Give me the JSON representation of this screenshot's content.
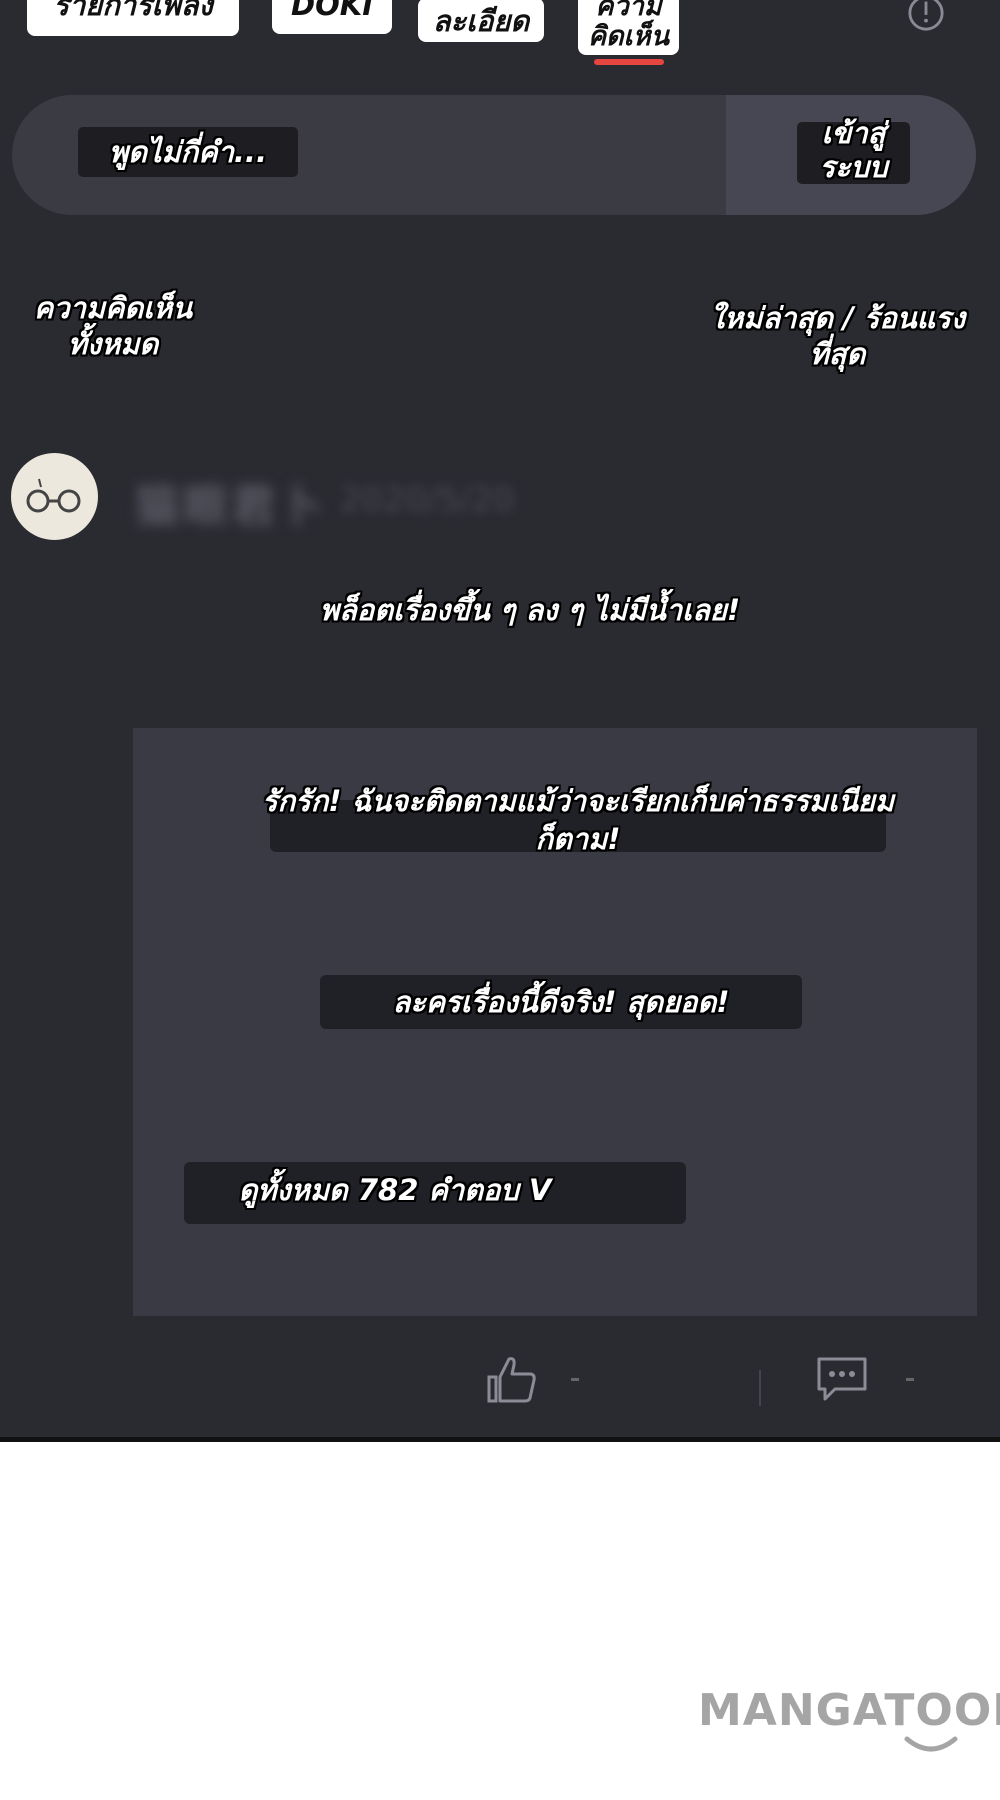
{
  "tabs": [
    {
      "label": "รายการเพลง"
    },
    {
      "label": "DOKI"
    },
    {
      "label": "ละเอียด"
    },
    {
      "label": "ความ\nคิดเห็น",
      "active": true,
      "accent": "#e5463f"
    }
  ],
  "comment_input": {
    "placeholder": "พูดไม่กี่คำ...",
    "login_label": "เข้าสู่\nระบบ"
  },
  "comments_header": {
    "title": "ความคิดเห็น\nทั้งหมด",
    "sort_label": "ใหม่ล่าสุด / ร้อนแรง\nที่สุด"
  },
  "comment": {
    "username": "猫眼君卜",
    "date": "2020/5/20",
    "text": "พล็อตเรื่องขึ้น ๆ ลง ๆ ไม่มีน้ำเลย!",
    "replies": [
      {
        "text": "รักรัก! ฉันจะติดตามแม้ว่าจะเรียกเก็บค่าธรรมเนียม\nก็ตาม!"
      },
      {
        "text": "ละครเรื่องนี้ดีจริง! สุดยอด!"
      }
    ],
    "view_all_replies": "ดูทั้งหมด 782 คำตอบ V"
  },
  "icons": [
    "info-icon",
    "avatar-glasses-icon",
    "like-icon",
    "reply-icon"
  ],
  "colors": {
    "background": "#2a2a31",
    "panel": "#3a3a45",
    "accent": "#e5463f"
  },
  "watermark": "MANGATOON"
}
